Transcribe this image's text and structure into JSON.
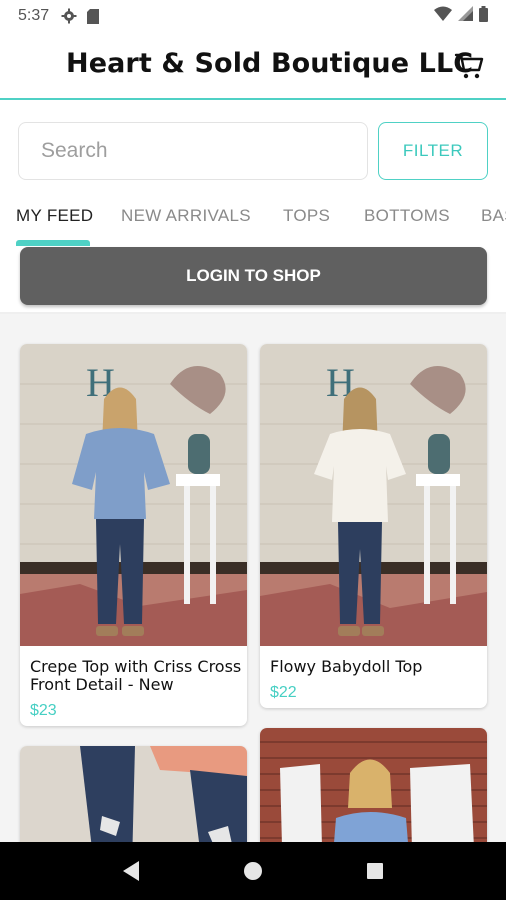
{
  "status_bar": {
    "time": "5:37",
    "icons": [
      "gear-icon",
      "sd-card-icon",
      "wifi-icon",
      "signal-icon",
      "battery-icon"
    ]
  },
  "app_bar": {
    "title": "Heart & Sold Boutique LLC",
    "cart_icon": "cart-icon"
  },
  "search": {
    "placeholder": "Search",
    "value": ""
  },
  "filter_label": "FILTER",
  "tabs": [
    {
      "label": "MY FEED",
      "active": true
    },
    {
      "label": "NEW ARRIVALS",
      "active": false
    },
    {
      "label": "TOPS",
      "active": false
    },
    {
      "label": "BOTTOMS",
      "active": false
    },
    {
      "label": "BAS",
      "active": false
    }
  ],
  "login_label": "LOGIN TO SHOP",
  "products": [
    {
      "name": "Crepe Top with Criss Cross Front Detail - New",
      "price": "$23",
      "top_color": "#7f9ec9"
    },
    {
      "name": "Flowy Babydoll Top",
      "price": "$22",
      "top_color": "#f4f1ea"
    },
    {
      "name": "",
      "price": ""
    },
    {
      "name": "",
      "price": ""
    }
  ],
  "colors": {
    "accent": "#4fd1c5",
    "login_bg": "#606060",
    "price": "#46cfc3"
  },
  "nav": {
    "back_icon": "back-triangle-icon",
    "home_icon": "home-circle-icon",
    "recents_icon": "recents-square-icon"
  }
}
